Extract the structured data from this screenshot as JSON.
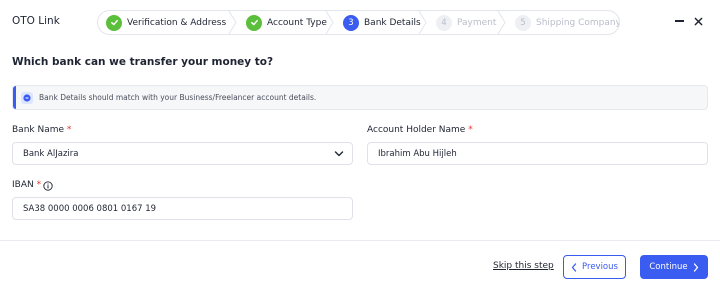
{
  "app": {
    "title": "OTO Link"
  },
  "stepper": {
    "steps": [
      {
        "number": "",
        "label": "Verification & Address",
        "state": "done"
      },
      {
        "number": "",
        "label": "Account Type",
        "state": "done"
      },
      {
        "number": "3",
        "label": "Bank Details",
        "state": "active"
      },
      {
        "number": "4",
        "label": "Payment",
        "state": "pending"
      },
      {
        "number": "5",
        "label": "Shipping Company",
        "state": "pending"
      }
    ]
  },
  "form": {
    "heading": "Which bank can we transfer your money to?",
    "info": "Bank Details should match with your Business/Freelancer account details.",
    "bank_name": {
      "label": "Bank Name",
      "required": "*",
      "value": "Bank AlJazira"
    },
    "account_holder": {
      "label": "Account Holder Name",
      "required": "*",
      "value": "Ibrahim Abu Hijleh"
    },
    "iban": {
      "label": "IBAN",
      "required": "*",
      "value": "SA38 0000 0006 0801 0167 19"
    }
  },
  "footer": {
    "skip_label": "Skip this step",
    "previous_label": "Previous",
    "continue_label": "Continue"
  },
  "colors": {
    "accent": "#3b5cf0",
    "success": "#5bbf3b",
    "required": "#e4352e"
  },
  "icons": [
    "check-icon",
    "minimize-icon",
    "close-icon",
    "info-icon",
    "chevron-down-icon",
    "chevron-left-icon",
    "chevron-right-icon"
  ]
}
